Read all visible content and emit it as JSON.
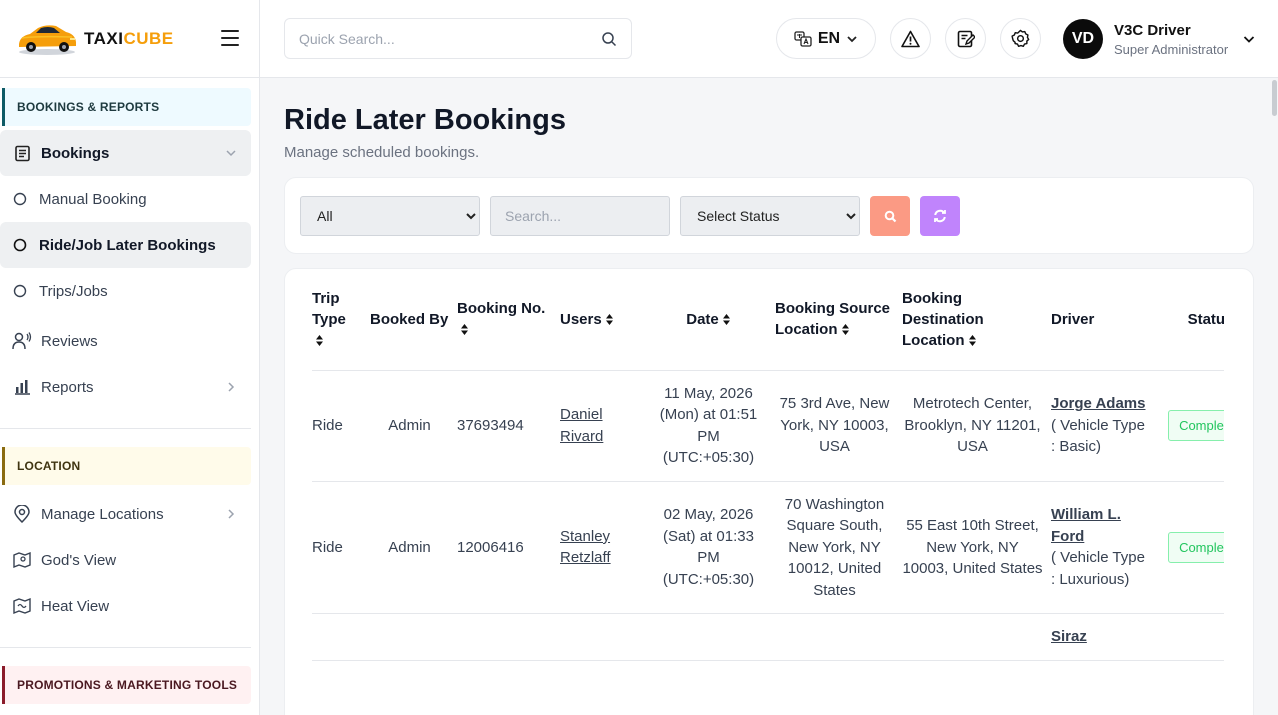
{
  "brand": {
    "part1": "TAXI",
    "part2": "CUBE"
  },
  "colors": {
    "accent": "#0f5b66",
    "search_btn": "#fb9a84",
    "refresh_btn": "#c084fc",
    "status_green": "#22c55e"
  },
  "sidebar": {
    "section1": "BOOKINGS & REPORTS",
    "bookings": "Bookings",
    "manual_booking": "Manual Booking",
    "ride_later": "Ride/Job Later Bookings",
    "trips": "Trips/Jobs",
    "reviews": "Reviews",
    "reports": "Reports",
    "section2": "LOCATION",
    "manage_locations": "Manage Locations",
    "gods_view": "God's View",
    "heat_view": "Heat View",
    "section3": "PROMOTIONS & MARKETING TOOLS"
  },
  "header": {
    "search_placeholder": "Quick Search...",
    "lang": "EN",
    "user_initials": "VD",
    "user_name": "V3C Driver",
    "user_role": "Super Administrator"
  },
  "page": {
    "title": "Ride Later Bookings",
    "subtitle": "Manage scheduled bookings."
  },
  "filters": {
    "type_selected": "All",
    "search_placeholder": "Search...",
    "status_selected": "Select Status"
  },
  "table": {
    "headers": {
      "trip_type": "Trip Type",
      "booked_by": "Booked By",
      "booking_no": "Booking No.",
      "users": "Users",
      "date": "Date",
      "source": "Booking Source Location",
      "destination": "Booking Destination Location",
      "driver": "Driver",
      "status": "Status"
    },
    "rows": [
      {
        "trip_type": "Ride",
        "booked_by": "Admin",
        "booking_no": "37693494",
        "user": "Daniel Rivard",
        "date": "11 May, 2026 (Mon) at 01:51 PM (UTC:+05:30)",
        "source": "75 3rd Ave, New York, NY 10003, USA",
        "destination": "Metrotech Center, Brooklyn, NY 11201, USA",
        "driver_name": "Jorge Adams",
        "driver_vehicle": "( Vehicle Type : Basic)",
        "status": "Completed"
      },
      {
        "trip_type": "Ride",
        "booked_by": "Admin",
        "booking_no": "12006416",
        "user": "Stanley Retzlaff",
        "date": "02 May, 2026 (Sat) at 01:33 PM (UTC:+05:30)",
        "source": "70 Washington Square South, New York, NY 10012, United States",
        "destination": "55 East 10th Street, New York, NY 10003, United States",
        "driver_name": "William L. Ford",
        "driver_vehicle": "( Vehicle Type : Luxurious)",
        "status": "Completed"
      },
      {
        "trip_type": "",
        "booked_by": "",
        "booking_no": "",
        "user": "",
        "date": "",
        "source": "",
        "destination": "",
        "driver_name": "Siraz",
        "driver_vehicle": "",
        "status": ""
      }
    ]
  }
}
